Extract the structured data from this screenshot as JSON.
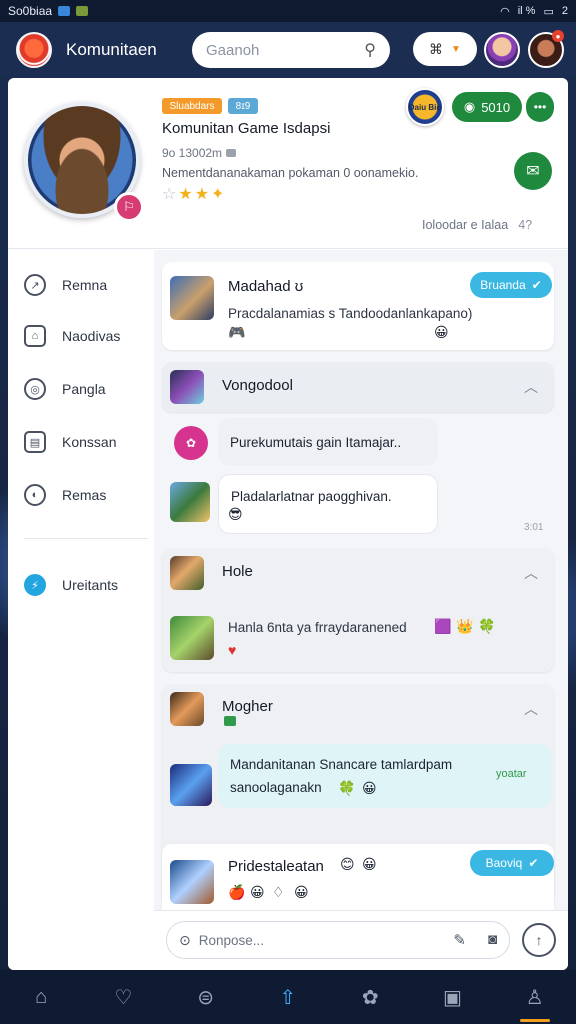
{
  "status_bar": {
    "left": "So0biaa",
    "right_signal": "il %",
    "right_battery": "2"
  },
  "app": {
    "title": "Komunitaen"
  },
  "search": {
    "placeholder": "Gaanoh"
  },
  "header_icons": {
    "search": "search-icon",
    "controller": "gamepad-icon"
  },
  "profile": {
    "tag1": "Sluabdars",
    "tag2": "8ɪ9",
    "name": "Komunitan Game Isdapsi",
    "meta": "9o 13002m",
    "description": "Nementdananakaman pokaman 0 oonamekio.",
    "stars_filled": 2,
    "stars_total": 4,
    "game_badge": "Daiu Bio",
    "follow_label": "5010",
    "footer_label": "Ioloodar e Ialaa",
    "footer_count": "4?"
  },
  "sidebar": {
    "items": [
      {
        "label": "Remna",
        "icon": "link-icon"
      },
      {
        "label": "Naodivas",
        "icon": "store-icon"
      },
      {
        "label": "Pangla",
        "icon": "target-icon"
      },
      {
        "label": "Konssan",
        "icon": "gallery-icon"
      },
      {
        "label": "Remas",
        "icon": "chat-icon"
      }
    ],
    "bottom_item": {
      "label": "Ureitants",
      "icon": "flash-icon"
    }
  },
  "feed": {
    "card1": {
      "title": "Madahad ʊ",
      "text": "Pracdalanamias s  Tandoodanlankapano)",
      "tag": "Bruanda"
    },
    "group1": {
      "title": "Vongodool",
      "bubble1": "Purekumutais gain Itamajar..",
      "bubble2": "Pladalarlatnar paogghivan.",
      "time": "3:01"
    },
    "group2": {
      "title": "Hole",
      "text": "Hanla 6nta ya frraydaranened"
    },
    "group3": {
      "title": "Mogher",
      "bubble_line1": "Mandanitanan  Snancare tamlardpam",
      "bubble_line2": "sanoolaganakn",
      "side_label": "yoatar"
    },
    "card_last": {
      "title": "Pridestaleatan",
      "tag": "Baoviq"
    }
  },
  "composer": {
    "placeholder": "Ronpose..."
  },
  "bottom_nav": [
    {
      "name": "home-icon"
    },
    {
      "name": "heart-icon"
    },
    {
      "name": "controller-icon"
    },
    {
      "name": "share-icon",
      "active": true
    },
    {
      "name": "flower-icon"
    },
    {
      "name": "bookmark-icon"
    },
    {
      "name": "profile-icon"
    }
  ],
  "colors": {
    "accent_green": "#1f8a3e",
    "accent_cyan": "#3bb7e3",
    "appbar": "#1c2d52",
    "active_tab": "#3ab0ff"
  }
}
